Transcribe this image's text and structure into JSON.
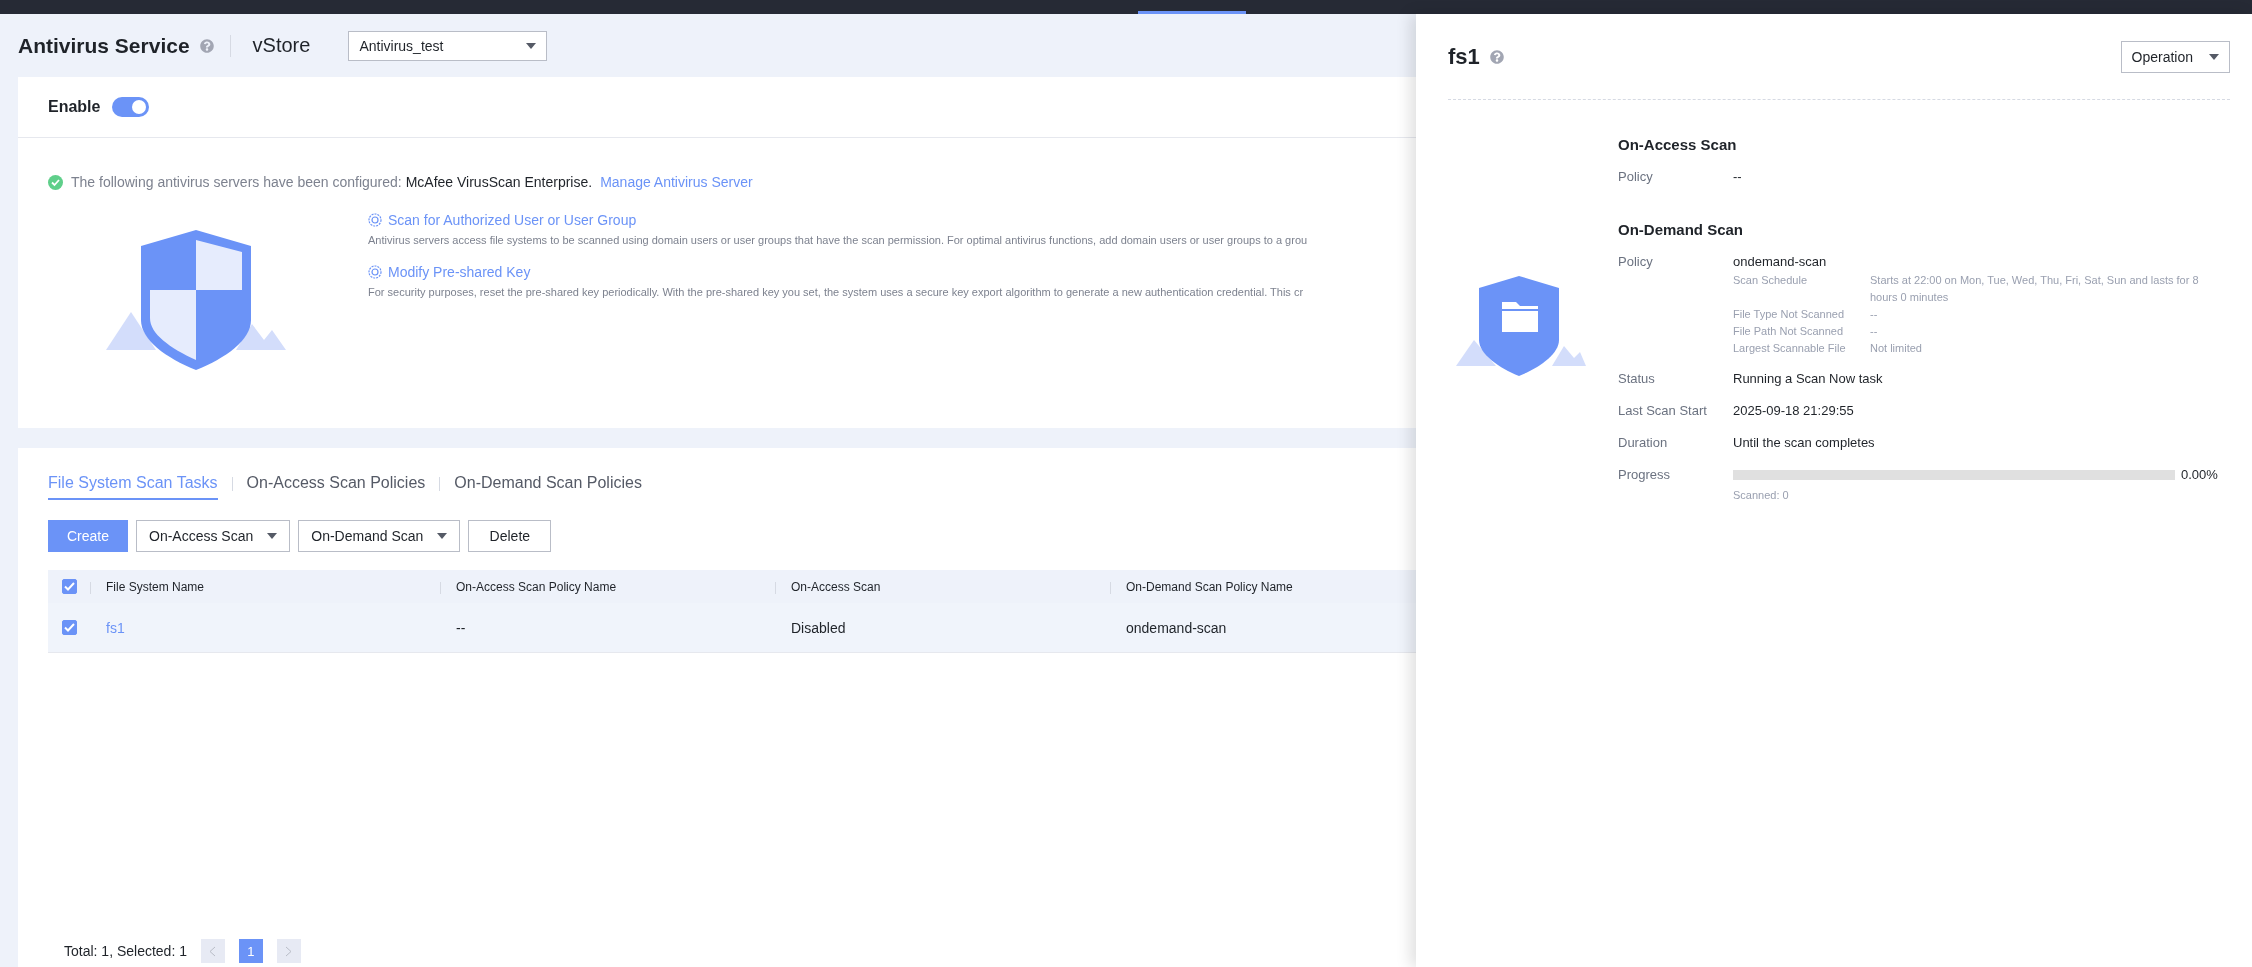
{
  "page": {
    "title": "Antivirus Service",
    "vstore_label": "vStore",
    "vstore_select": {
      "value": "Antivirus_test"
    }
  },
  "enable": {
    "label": "Enable",
    "on": true
  },
  "notice": {
    "text": "The following antivirus servers have been configured: ",
    "server": "McAfee VirusScan Enterprise.",
    "link": "Manage Antivirus Server"
  },
  "tips": [
    {
      "title": "Scan for Authorized User or User Group",
      "description": "Antivirus servers access file systems to be scanned using domain users or user groups that have the scan permission. For optimal antivirus functions, add domain users or user groups to a grou"
    },
    {
      "title": "Modify Pre-shared Key",
      "description": "For security purposes, reset the pre-shared key periodically. With the pre-shared key you set, the system uses a secure key export algorithm to generate a new authentication credential. This cr"
    }
  ],
  "tabs": [
    {
      "label": "File System Scan Tasks",
      "selected": true
    },
    {
      "label": "On-Access Scan Policies",
      "selected": false
    },
    {
      "label": "On-Demand Scan Policies",
      "selected": false
    }
  ],
  "toolbar": [
    {
      "label": "Create",
      "kind": "primary"
    },
    {
      "label": "On-Access Scan",
      "kind": "dropdown"
    },
    {
      "label": "On-Demand Scan",
      "kind": "dropdown"
    },
    {
      "label": "Delete",
      "kind": "plain"
    }
  ],
  "table": {
    "all_checked": true,
    "columns": [
      "File System Name",
      "On-Access Scan Policy Name",
      "On-Access Scan",
      "On-Demand Scan Policy Name"
    ],
    "rows": [
      {
        "checked": true,
        "cells": [
          "fs1",
          "--",
          "Disabled",
          "ondemand-scan"
        ]
      }
    ]
  },
  "pagination": {
    "summary": "Total: 1, Selected: 1",
    "pages": [
      {
        "label": "1",
        "selected": true
      }
    ]
  },
  "drawer": {
    "title": "fs1",
    "operation": "Operation",
    "sections": [
      {
        "heading": "On-Access Scan",
        "fields": [
          {
            "kind": "text",
            "label": "Policy",
            "value": "--"
          }
        ]
      },
      {
        "heading": "On-Demand Scan",
        "fields": [
          {
            "kind": "text",
            "label": "Policy",
            "value": "ondemand-scan",
            "details": [
              {
                "label": "Scan Schedule",
                "value": "Starts at 22:00 on Mon, Tue, Wed, Thu, Fri, Sat, Sun and lasts for 8 hours 0 minutes"
              },
              {
                "label": "File Type Not Scanned",
                "value": "--"
              },
              {
                "label": "File Path Not Scanned",
                "value": "--"
              },
              {
                "label": "Largest Scannable File",
                "value": "Not limited"
              }
            ]
          },
          {
            "kind": "text",
            "label": "Status",
            "value": "Running a Scan Now task"
          },
          {
            "kind": "text",
            "label": "Last Scan Start",
            "value": "2025-09-18 21:29:55"
          },
          {
            "kind": "text",
            "label": "Duration",
            "value": "Until the scan completes"
          },
          {
            "kind": "progress",
            "label": "Progress",
            "level": 0,
            "value": "0.00%",
            "note": "Scanned: 0"
          }
        ]
      }
    ]
  }
}
